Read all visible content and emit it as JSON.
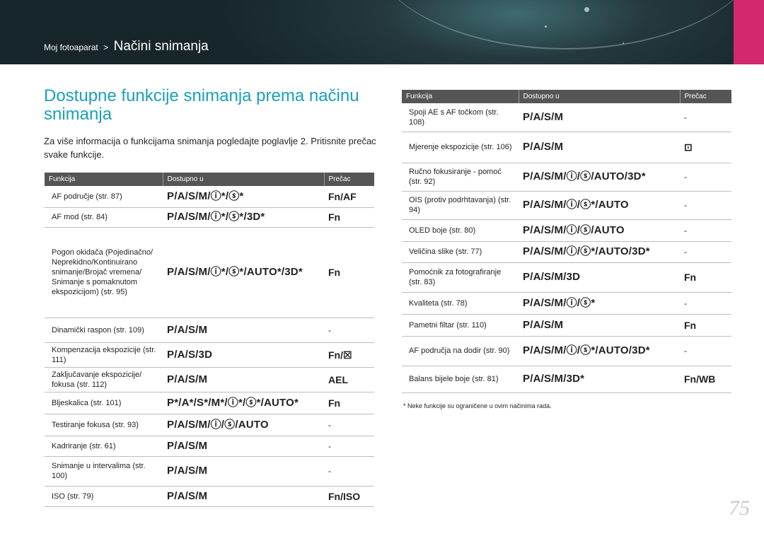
{
  "header": {
    "crumb_parent": "Moj fotoaparat",
    "crumb_separator": ">",
    "crumb_current": "Načini snimanja",
    "accent_color": "#d3276e"
  },
  "title": "Dostupne funkcije snimanja prema načinu snimanja",
  "intro": "Za više informacija o funkcijama snimanja pogledajte poglavlje 2. Pritisnite prečac svake funkcije.",
  "columns": {
    "function": "Funkcija",
    "available": "Dostupno u",
    "shortcut": "Prečac"
  },
  "left_table": [
    {
      "function": "AF područje (str. 87)",
      "available": "P/A/S/M/ⓘ*/ⓢ*",
      "shortcut": "Fn/AF"
    },
    {
      "function": "AF mod (str. 84)",
      "available": "P/A/S/M/ⓘ*/ⓢ*/3D*",
      "shortcut": "Fn"
    },
    {
      "function": "Pogon okidača (Pojedinačno/ Neprekidno/Kontinuirano snimanje/Brojač vremena/ Snimanje s pomaknutom ekspozicijom) (str. 95)",
      "available": "P/A/S/M/ⓘ*/ⓢ*/AUTO*/3D*",
      "shortcut": "Fn"
    },
    {
      "function": "Dinamički raspon (str. 109)",
      "available": "P/A/S/M",
      "shortcut": "-"
    },
    {
      "function": "Kompenzacija ekspozicije (str. 111)",
      "available": "P/A/S/3D",
      "shortcut": "Fn/☒"
    },
    {
      "function": "Zaključavanje ekspozicije/ fokusa (str. 112)",
      "available": "P/A/S/M",
      "shortcut": "AEL"
    },
    {
      "function": "Bljeskalica (str. 101)",
      "available": "P*/A*/S*/M*/ⓘ*/ⓢ*/AUTO*",
      "shortcut": "Fn"
    },
    {
      "function": "Testiranje fokusa (str. 93)",
      "available": "P/A/S/M/ⓘ/ⓢ/AUTO",
      "shortcut": "-"
    },
    {
      "function": "Kadriranje (str. 61)",
      "available": "P/A/S/M",
      "shortcut": "-"
    },
    {
      "function": "Snimanje u intervalima (str. 100)",
      "available": "P/A/S/M",
      "shortcut": "-"
    },
    {
      "function": "ISO (str. 79)",
      "available": "P/A/S/M",
      "shortcut": "Fn/ISO"
    }
  ],
  "right_table": [
    {
      "function": "Spoji AE s AF točkom (str. 108)",
      "available": "P/A/S/M",
      "shortcut": "-"
    },
    {
      "function": "Mjerenje ekspozicije (str. 106)",
      "available": "P/A/S/M",
      "shortcut": "⊡"
    },
    {
      "function": "Ručno fokusiranje - pomoć (str. 92)",
      "available": "P/A/S/M/ⓘ/ⓢ/AUTO/3D*",
      "shortcut": "-"
    },
    {
      "function": "OIS (protiv podrhtavanja) (str. 94)",
      "available": "P/A/S/M/ⓘ/ⓢ*/AUTO",
      "shortcut": "-"
    },
    {
      "function": "OLED boje (str. 80)",
      "available": "P/A/S/M/ⓘ/ⓢ/AUTO",
      "shortcut": "-"
    },
    {
      "function": "Veličina slike (str. 77)",
      "available": "P/A/S/M/ⓘ/ⓢ*/AUTO/3D*",
      "shortcut": "-"
    },
    {
      "function": "Pomoćnik za fotografiranje (str. 83)",
      "available": "P/A/S/M/3D",
      "shortcut": "Fn"
    },
    {
      "function": "Kvaliteta (str. 78)",
      "available": "P/A/S/M/ⓘ/ⓢ*",
      "shortcut": "-"
    },
    {
      "function": "Pametni filtar (str. 110)",
      "available": "P/A/S/M",
      "shortcut": "Fn"
    },
    {
      "function": "AF područja na dodir (str. 90)",
      "available": "P/A/S/M/ⓘ/ⓢ*/AUTO/3D*",
      "shortcut": "-"
    },
    {
      "function": "Balans bijele boje (str. 81)",
      "available": "P/A/S/M/3D*",
      "shortcut": "Fn/WB"
    }
  ],
  "footnote": "* Neke funkcije su ograničene u ovim načinima rada.",
  "page_number": "75"
}
